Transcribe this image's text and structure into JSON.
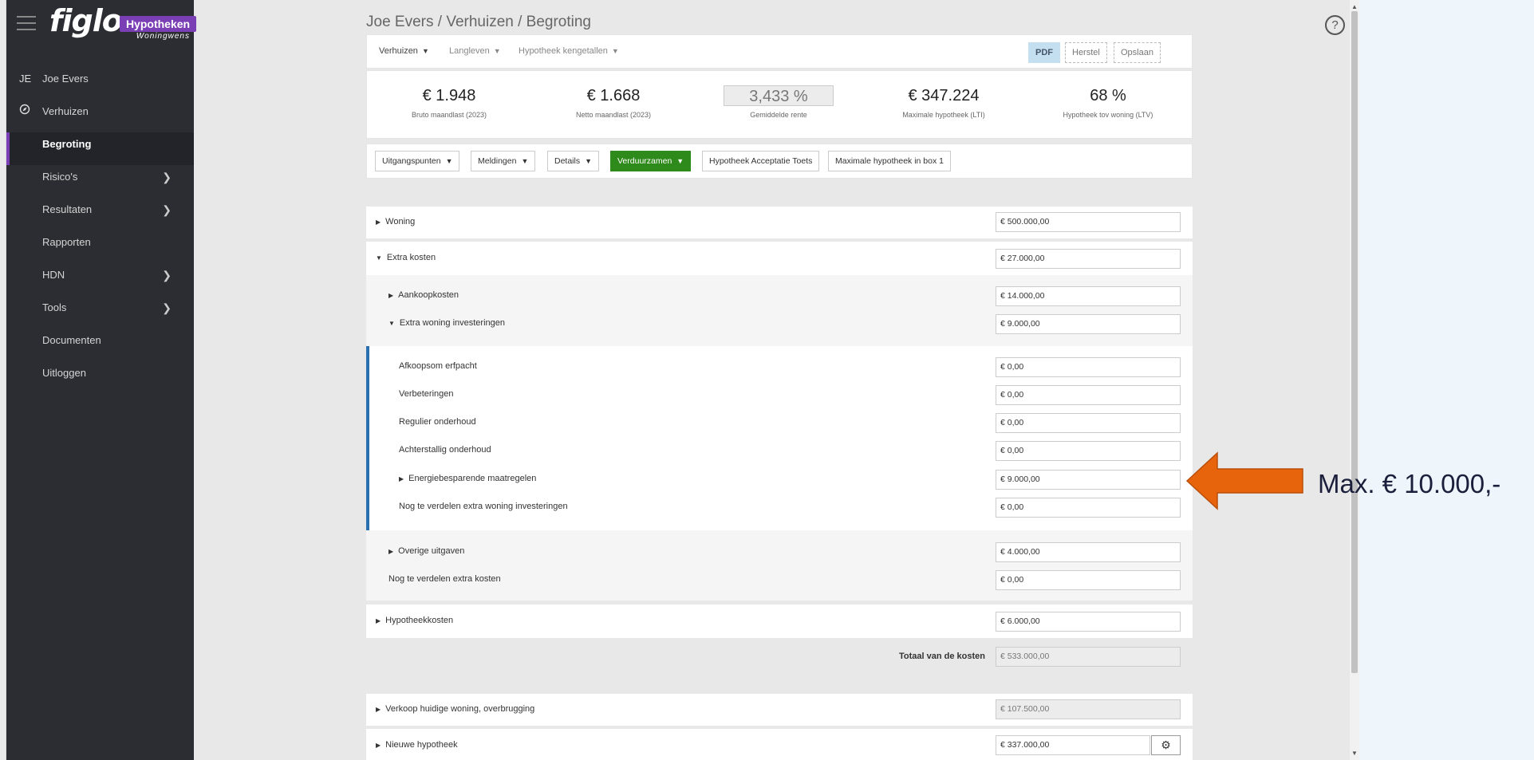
{
  "app": {
    "logo": "figlo",
    "brand": "Hypotheken",
    "brand_sub": "Woningwens"
  },
  "sidebar": {
    "user_initials": "JE",
    "items": [
      {
        "label": "Joe Evers"
      },
      {
        "label": "Verhuizen"
      },
      {
        "label": "Begroting"
      },
      {
        "label": "Risico's"
      },
      {
        "label": "Resultaten"
      },
      {
        "label": "Rapporten"
      },
      {
        "label": "HDN"
      },
      {
        "label": "Tools"
      },
      {
        "label": "Documenten"
      },
      {
        "label": "Uitloggen"
      }
    ]
  },
  "breadcrumb": "Joe Evers / Verhuizen / Begroting",
  "topnav": {
    "items": [
      "Verhuizen",
      "Langleven",
      "Hypotheek kengetallen"
    ],
    "pdf": "PDF",
    "herstel": "Herstel",
    "opslaan": "Opslaan"
  },
  "stats": [
    {
      "value": "€ 1.948",
      "label": "Bruto maandlast (2023)"
    },
    {
      "value": "€ 1.668",
      "label": "Netto maandlast (2023)"
    },
    {
      "value": "3,433 %",
      "label": "Gemiddelde rente"
    },
    {
      "value": "€ 347.224",
      "label": "Maximale hypotheek (LTI)"
    },
    {
      "value": "68 %",
      "label": "Hypotheek tov woning (LTV)"
    }
  ],
  "tabs": [
    "Uitgangspunten",
    "Meldingen",
    "Details",
    "Verduurzamen",
    "Hypotheek Acceptatie Toets",
    "Maximale hypotheek in box 1"
  ],
  "rows": {
    "woning": {
      "label": "Woning",
      "value": "€ 500.000,00"
    },
    "extra_kosten": {
      "label": "Extra kosten",
      "value": "€ 27.000,00"
    },
    "aankoopkosten": {
      "label": "Aankoopkosten",
      "value": "€ 14.000,00"
    },
    "extra_woning": {
      "label": "Extra woning investeringen",
      "value": "€ 9.000,00"
    },
    "afkoopsom": {
      "label": "Afkoopsom erfpacht",
      "value": "€ 0,00"
    },
    "verbeteringen": {
      "label": "Verbeteringen",
      "value": "€ 0,00"
    },
    "regulier": {
      "label": "Regulier onderhoud",
      "value": "€ 0,00"
    },
    "achterstallig": {
      "label": "Achterstallig onderhoud",
      "value": "€ 0,00"
    },
    "energie": {
      "label": "Energiebesparende maatregelen",
      "value": "€ 9.000,00"
    },
    "nog_investeringen": {
      "label": "Nog te verdelen extra woning investeringen",
      "value": "€ 0,00"
    },
    "overige": {
      "label": "Overige uitgaven",
      "value": "€ 4.000,00"
    },
    "nog_kosten": {
      "label": "Nog te verdelen extra kosten",
      "value": "€ 0,00"
    },
    "hypotheekkosten": {
      "label": "Hypotheekkosten",
      "value": "€ 6.000,00"
    },
    "totaal": {
      "label": "Totaal van de kosten",
      "value": "€ 533.000,00"
    },
    "verkoop": {
      "label": "Verkoop huidige woning, overbrugging",
      "value": "€ 107.500,00"
    },
    "nieuwe_hypotheek": {
      "label": "Nieuwe hypotheek",
      "value": "€ 337.000,00"
    }
  },
  "callout": {
    "text": "Max. € 10.000,-",
    "color": "#e8640c"
  }
}
